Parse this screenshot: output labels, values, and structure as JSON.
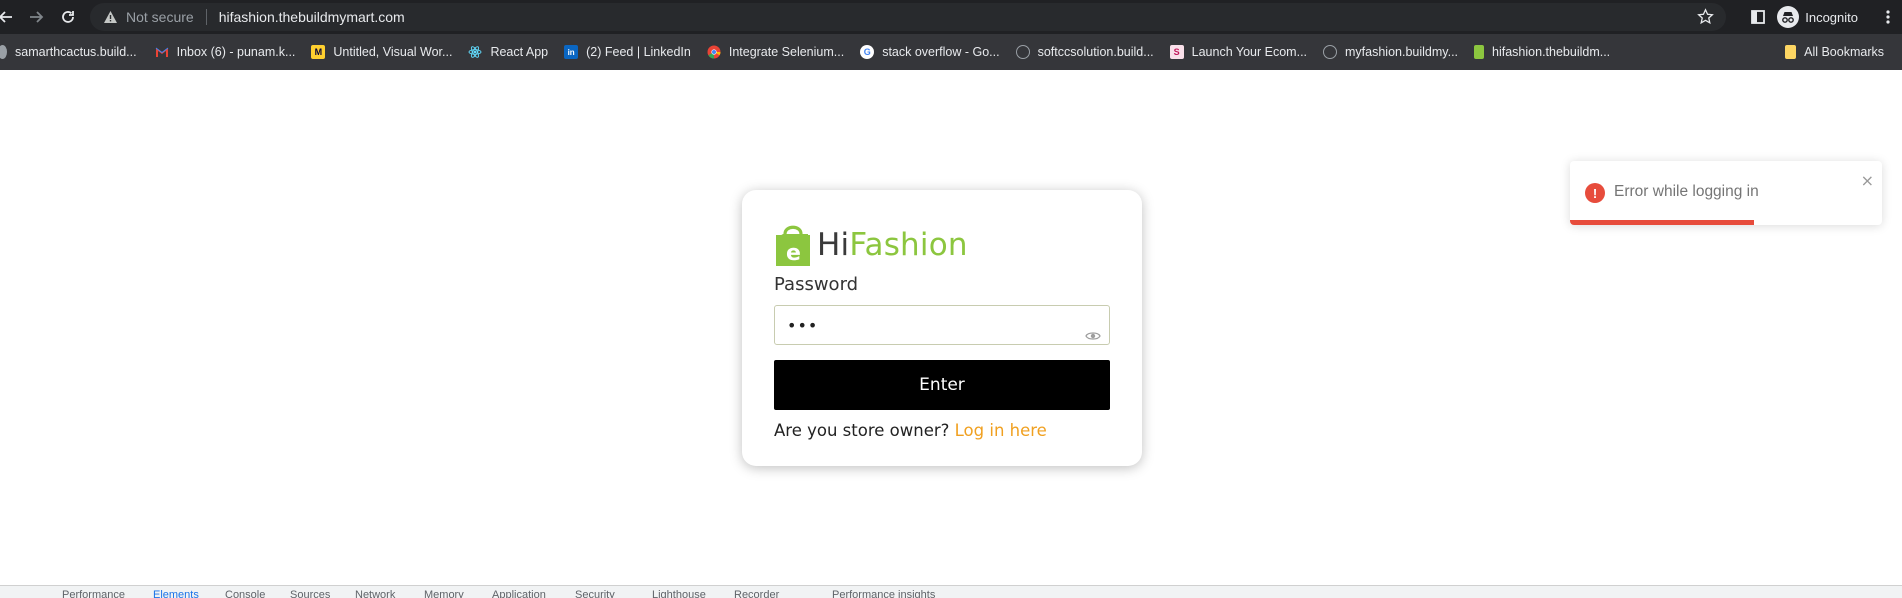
{
  "browser": {
    "security_label": "Not secure",
    "url": "hifashion.thebuildmymart.com",
    "incognito_label": "Incognito"
  },
  "bookmarks": [
    {
      "label": "samarthcactus.build...",
      "icon": "globe-icon"
    },
    {
      "label": "Inbox (6) - punam.k...",
      "icon": "gmail-icon"
    },
    {
      "label": "Untitled, Visual Wor...",
      "icon": "miro-icon"
    },
    {
      "label": "React App",
      "icon": "react-icon"
    },
    {
      "label": "(2) Feed | LinkedIn",
      "icon": "linkedin-icon"
    },
    {
      "label": "Integrate Selenium...",
      "icon": "chrome-icon"
    },
    {
      "label": "stack overflow - Go...",
      "icon": "google-icon"
    },
    {
      "label": "softccsolution.build...",
      "icon": "globe-icon"
    },
    {
      "label": "Launch Your Ecom...",
      "icon": "store-icon"
    },
    {
      "label": "myfashion.buildmy...",
      "icon": "globe-icon"
    },
    {
      "label": "hifashion.thebuildm...",
      "icon": "hifashion-icon"
    }
  ],
  "all_bookmarks_label": "All Bookmarks",
  "logo": {
    "hi": "Hi",
    "fashion": "Fashion"
  },
  "login": {
    "password_label": "Password",
    "password_value": "•••",
    "enter_label": "Enter",
    "owner_question": "Are you store owner?",
    "owner_link": "Log in here"
  },
  "toast": {
    "message": "Error while logging in",
    "close_symbol": "×",
    "progress_fraction": 0.59,
    "color": "#e74c3c"
  },
  "devtools": {
    "tabs": [
      "Performance",
      "Elements",
      "Console",
      "Sources",
      "Network",
      "Memory",
      "Application",
      "Security",
      "Lighthouse",
      "Recorder",
      "Performance insights"
    ],
    "active_tab": "Elements"
  },
  "colors": {
    "brand_green": "#8cc63f",
    "link_orange": "#f0a020",
    "button_black": "#000000"
  }
}
